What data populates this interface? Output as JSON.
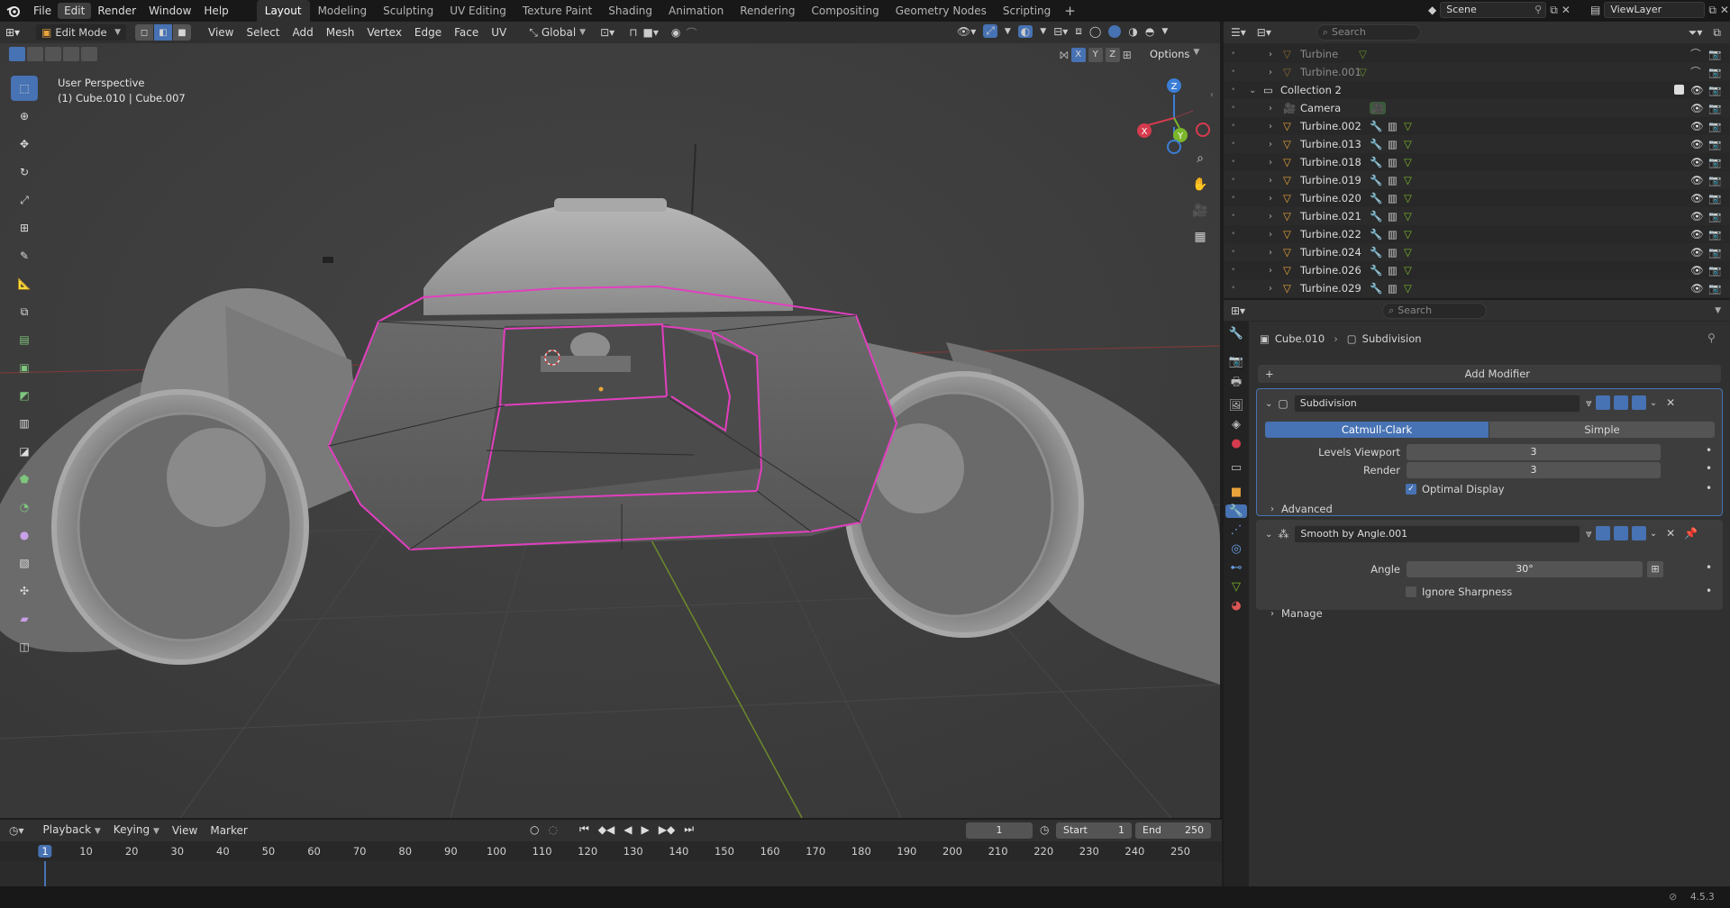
{
  "topbar": {
    "menus": [
      "File",
      "Edit",
      "Render",
      "Window",
      "Help"
    ],
    "active_menu": "Edit",
    "workspaces": [
      "Layout",
      "Modeling",
      "Sculpting",
      "UV Editing",
      "Texture Paint",
      "Shading",
      "Animation",
      "Rendering",
      "Compositing",
      "Geometry Nodes",
      "Scripting"
    ],
    "active_workspace": "Layout",
    "scene": "Scene",
    "view_layer": "ViewLayer"
  },
  "viewport_header": {
    "mode": "Edit Mode",
    "menus": [
      "View",
      "Select",
      "Add",
      "Mesh",
      "Vertex",
      "Edge",
      "Face",
      "UV"
    ],
    "transform_orientation": "Global",
    "options": "Options",
    "axes": [
      "X",
      "Y",
      "Z"
    ]
  },
  "viewport": {
    "view_name": "User Perspective",
    "object_info": "(1) Cube.010 | Cube.007",
    "gizmo_axes": {
      "x": "X",
      "y": "Y",
      "z": "Z"
    },
    "colors": {
      "x": "#d53b4d",
      "y": "#7bb62b",
      "z": "#3b7ed5",
      "selection": "#e23fbf"
    }
  },
  "outliner": {
    "search_placeholder": "Search",
    "rows": [
      {
        "name": "Turbine",
        "indent": 1,
        "type": "mesh",
        "dim": true
      },
      {
        "name": "Turbine.001",
        "indent": 1,
        "type": "mesh",
        "dim": true
      },
      {
        "name": "Collection 2",
        "indent": 0,
        "type": "collection",
        "dim": false
      },
      {
        "name": "Camera",
        "indent": 1,
        "type": "camera",
        "dim": false
      },
      {
        "name": "Turbine.002",
        "indent": 1,
        "type": "mesh",
        "dim": false
      },
      {
        "name": "Turbine.013",
        "indent": 1,
        "type": "mesh",
        "dim": false
      },
      {
        "name": "Turbine.018",
        "indent": 1,
        "type": "mesh",
        "dim": false
      },
      {
        "name": "Turbine.019",
        "indent": 1,
        "type": "mesh",
        "dim": false
      },
      {
        "name": "Turbine.020",
        "indent": 1,
        "type": "mesh",
        "dim": false
      },
      {
        "name": "Turbine.021",
        "indent": 1,
        "type": "mesh",
        "dim": false
      },
      {
        "name": "Turbine.022",
        "indent": 1,
        "type": "mesh",
        "dim": false
      },
      {
        "name": "Turbine.024",
        "indent": 1,
        "type": "mesh",
        "dim": false
      },
      {
        "name": "Turbine.026",
        "indent": 1,
        "type": "mesh",
        "dim": false
      },
      {
        "name": "Turbine.029",
        "indent": 1,
        "type": "mesh",
        "dim": false
      }
    ]
  },
  "properties": {
    "search_placeholder": "Search",
    "breadcrumb_object": "Cube.010",
    "breadcrumb_modifier": "Subdivision",
    "add_modifier": "Add Modifier",
    "subdivision": {
      "name": "Subdivision",
      "mode_catmull": "Catmull-Clark",
      "mode_simple": "Simple",
      "levels_viewport_label": "Levels Viewport",
      "levels_viewport": "3",
      "render_label": "Render",
      "render": "3",
      "optimal_display": "Optimal Display",
      "advanced": "Advanced"
    },
    "smooth": {
      "name": "Smooth by Angle.001",
      "angle_label": "Angle",
      "angle": "30°",
      "ignore_sharpness": "Ignore Sharpness",
      "manage": "Manage"
    }
  },
  "timeline": {
    "menus": [
      "Playback",
      "Keying",
      "View",
      "Marker"
    ],
    "current_frame": "1",
    "start_label": "Start",
    "start": "1",
    "end_label": "End",
    "end": "250",
    "ruler": [
      "1",
      "10",
      "20",
      "30",
      "40",
      "50",
      "60",
      "70",
      "80",
      "90",
      "100",
      "110",
      "120",
      "130",
      "140",
      "150",
      "160",
      "170",
      "180",
      "190",
      "200",
      "210",
      "220",
      "230",
      "240",
      "250"
    ]
  },
  "status": {
    "version": "4.5.3"
  }
}
